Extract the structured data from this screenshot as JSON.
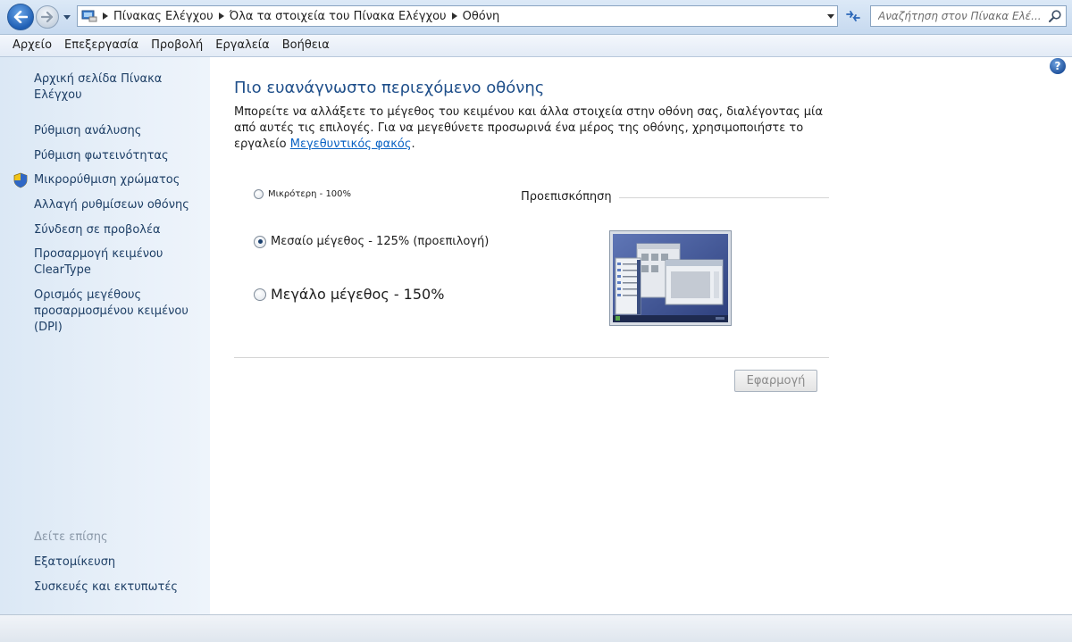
{
  "address_bar": {
    "breadcrumbs": [
      "Πίνακας Ελέγχου",
      "Όλα τα στοιχεία του Πίνακα Ελέγχου",
      "Οθόνη"
    ],
    "search_placeholder": "Αναζήτηση στον Πίνακα Ελέ..."
  },
  "menu": {
    "items": [
      "Αρχείο",
      "Επεξεργασία",
      "Προβολή",
      "Εργαλεία",
      "Βοήθεια"
    ]
  },
  "sidebar": {
    "links": [
      "Αρχική σελίδα Πίνακα Ελέγχου",
      "Ρύθμιση ανάλυσης",
      "Ρύθμιση φωτεινότητας",
      "Μικρορύθμιση χρώματος",
      "Αλλαγή ρυθμίσεων οθόνης",
      "Σύνδεση σε προβολέα",
      "Προσαρμογή κειμένου ClearType",
      "Ορισμός μεγέθους προσαρμοσμένου κειμένου (DPI)"
    ],
    "see_also_label": "Δείτε επίσης",
    "see_also_links": [
      "Εξατομίκευση",
      "Συσκευές και εκτυπωτές"
    ]
  },
  "main": {
    "title": "Πιο ευανάγνωστο περιεχόμενο οθόνης",
    "description": "Μπορείτε να αλλάξετε το μέγεθος του κειμένου και άλλα στοιχεία στην οθόνη σας, διαλέγοντας μία από αυτές τις επιλογές. Για να μεγεθύνετε προσωρινά ένα μέρος της οθόνης, χρησιμοποιήστε το εργαλείο ",
    "magnifier_link": "Μεγεθυντικός φακός",
    "description_end": ".",
    "options": [
      {
        "label": "Μικρότερη - 100%",
        "selected": false
      },
      {
        "label": "Μεσαίο μέγεθος - 125% (προεπιλογή)",
        "selected": true
      },
      {
        "label": "Μεγάλο μέγεθος  - 150%",
        "selected": false
      }
    ],
    "preview_label": "Προεπισκόπηση",
    "apply_label": "Εφαρμογή",
    "help_glyph": "?"
  },
  "colors": {
    "title": "#1f4f8a",
    "link": "#1e3f66",
    "accent_link": "#0b63c4",
    "sidebar_bg": "#dbe8f5"
  }
}
